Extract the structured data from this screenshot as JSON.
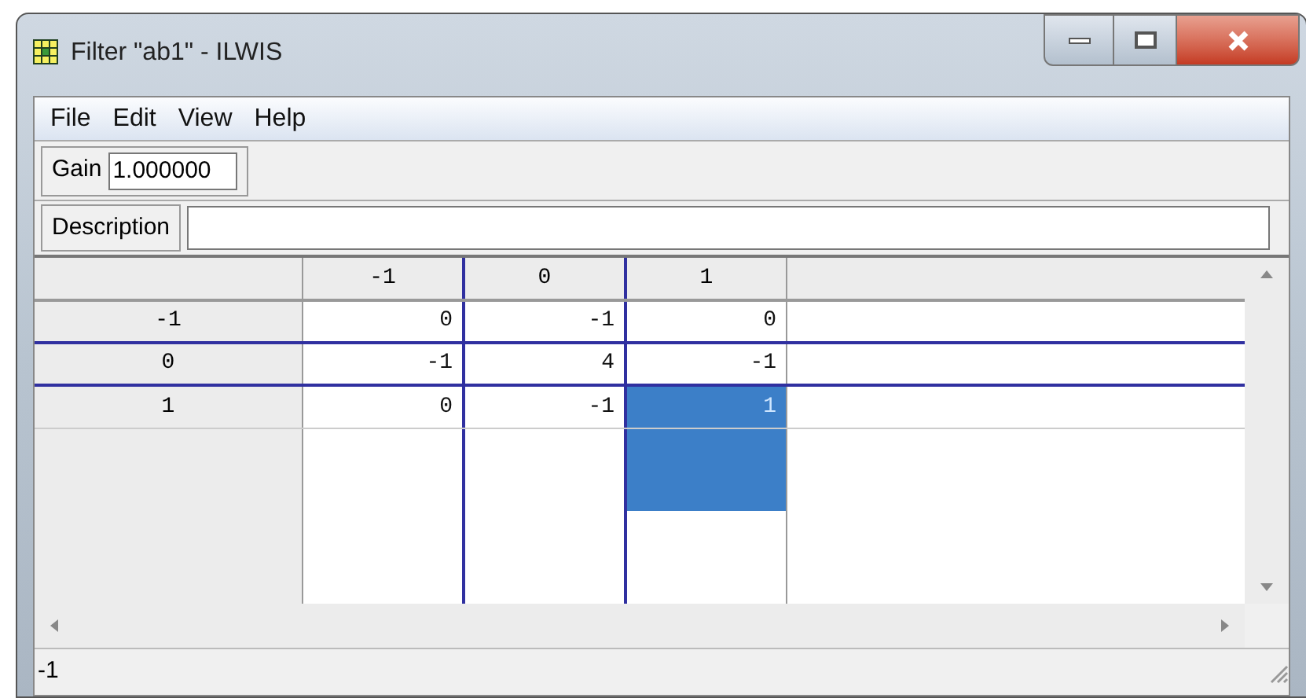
{
  "window": {
    "title": "Filter \"ab1\" - ILWIS"
  },
  "menu": [
    "File",
    "Edit",
    "View",
    "Help"
  ],
  "gain": {
    "label": "Gain",
    "value": "1.000000"
  },
  "description": {
    "label": "Description"
  },
  "grid": {
    "columns": [
      {
        "label": "-1",
        "selected_below": false
      },
      {
        "label": "0",
        "selected_below": false
      },
      {
        "label": "1",
        "selected_below": true
      }
    ],
    "rows": [
      {
        "label": "-1",
        "cells": [
          {
            "text": "0",
            "selected": false
          },
          {
            "text": "-1",
            "selected": false
          },
          {
            "text": "0",
            "selected": false
          }
        ]
      },
      {
        "label": "0",
        "cells": [
          {
            "text": "-1",
            "selected": false
          },
          {
            "text": "4",
            "selected": false
          },
          {
            "text": "-1",
            "selected": false
          }
        ]
      },
      {
        "label": "1",
        "cells": [
          {
            "text": "0",
            "selected": false
          },
          {
            "text": "-1",
            "selected": false
          },
          {
            "text": "1",
            "selected": true
          }
        ]
      }
    ]
  },
  "status_bar": "-1"
}
